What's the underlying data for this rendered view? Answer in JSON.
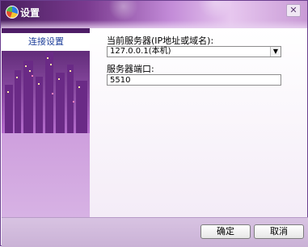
{
  "window": {
    "title": "设置",
    "close_label": "✕"
  },
  "sidebar": {
    "items": [
      {
        "label": "连接设置",
        "selected": true
      }
    ]
  },
  "form": {
    "server_label": "当前服务器(IP地址或域名):",
    "server_value": "127.0.0.1(本机)",
    "server_arrow": "▼",
    "port_label": "服务器端口:",
    "port_value": "5510"
  },
  "footer": {
    "ok_label": "确定",
    "cancel_label": "取消"
  },
  "colors": {
    "accent": "#7a3a8f",
    "link": "#1e3f9a"
  }
}
